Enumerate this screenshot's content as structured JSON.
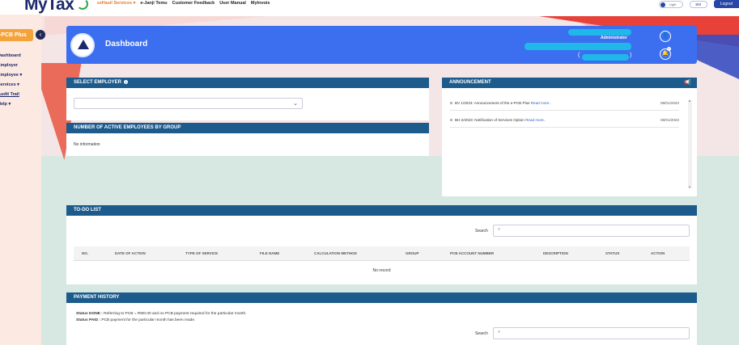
{
  "brand": {
    "logo_text": "MyTax"
  },
  "topnav": {
    "items": [
      "ezHasil Services ▾",
      "e-Janji Temu",
      "Customer Feedback",
      "User Manual",
      "MyInvois"
    ]
  },
  "topright": {
    "toggle_label": "Light",
    "lang_label": "BM",
    "logout_label": "Logout"
  },
  "sidebar": {
    "title": "e-PCB Plus",
    "collapse_icon": "‹",
    "items": [
      {
        "label": "Dashboard"
      },
      {
        "label": "Employer"
      },
      {
        "label": "Employee ▾"
      },
      {
        "label": "Services ▾"
      },
      {
        "label": "Audit Trail"
      },
      {
        "label": "Help ▾"
      }
    ]
  },
  "banner": {
    "title": "Dashboard",
    "role": "Administrator",
    "paren_open": "(",
    "paren_close": ")",
    "user_icon": "👤",
    "bell_icon": "🔔",
    "bell_badge": "0"
  },
  "select_employer": {
    "header": "SELECT EMPLOYER",
    "info_icon": "i",
    "chevron": "⌄"
  },
  "active_employees": {
    "header": "NUMBER OF ACTIVE EMPLOYEES BY GROUP",
    "empty_text": "No information"
  },
  "announcement": {
    "header": "ANNOUNCEMENT",
    "icon": "📢",
    "items": [
      {
        "text": "BV 1/2023: Announcement of the e-PCB Plus",
        "more": "Read more..",
        "date": "08/01/2023"
      },
      {
        "text": "BH 2/2023: Notification of Services Option",
        "more": "Read more..",
        "date": "08/01/2023"
      }
    ]
  },
  "todo": {
    "header": "TO-DO LIST",
    "search_label": "Search",
    "search_icon": "⌕",
    "columns": [
      "NO.",
      "DATE OF ACTION",
      "TYPE OF SERVICE",
      "FILE NAME",
      "CALCULATION METHOD",
      "GROUP",
      "PCB ACCOUNT NUMBER",
      "DESCRIPTION",
      "STATUS",
      "ACTION"
    ],
    "empty_text": "No record"
  },
  "payment_history": {
    "header": "PAYMENT HISTORY",
    "status_done_label": "Status DONE :",
    "status_done_text": " Referring to PCB = RM0.00 and no PCB payment required for the particular month.",
    "status_paid_label": "Status PAID :",
    "status_paid_text": " PCB payment for the particular month has been made.",
    "search_label": "Search",
    "search_icon": "⌕"
  }
}
